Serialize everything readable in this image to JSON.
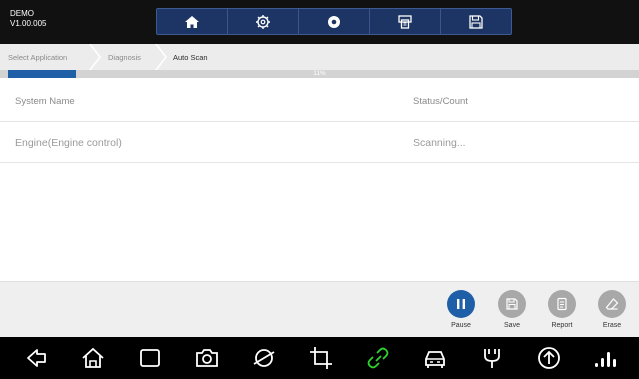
{
  "app": {
    "name": "DEMO",
    "version": "V1.00.005"
  },
  "toolbar": {
    "icons": [
      "home-icon",
      "gear-icon",
      "record-icon",
      "print-icon",
      "save-icon"
    ]
  },
  "breadcrumb": {
    "items": [
      "Select Application",
      "Diagnosis",
      "Auto Scan"
    ]
  },
  "progress": {
    "text": "11%",
    "value": 11
  },
  "table": {
    "headers": {
      "system": "System Name",
      "status": "Status/Count"
    },
    "rows": [
      {
        "system": "Engine(Engine control)",
        "status": "Scanning..."
      }
    ]
  },
  "actions": {
    "pause": "Pause",
    "save": "Save",
    "report": "Report",
    "erase": "Erase"
  },
  "colors": {
    "accent": "#1f5fa8",
    "toolbar_bg": "#1d3564",
    "disabled": "#9a9a9a"
  },
  "navbar": {
    "icons": [
      "back-icon",
      "home-icon",
      "recent-apps-icon",
      "camera-icon",
      "browser-icon",
      "crop-icon",
      "link-icon",
      "car-icon",
      "vci-icon",
      "upload-icon",
      "signal-icon"
    ]
  }
}
